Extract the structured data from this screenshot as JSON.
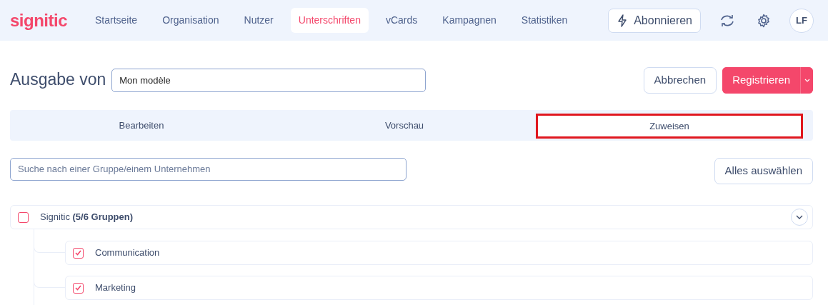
{
  "brand": "signitic",
  "nav": [
    {
      "label": "Startseite",
      "selected": false
    },
    {
      "label": "Organisation",
      "selected": false
    },
    {
      "label": "Nutzer",
      "selected": false
    },
    {
      "label": "Unterschriften",
      "selected": true
    },
    {
      "label": "vCards",
      "selected": false
    },
    {
      "label": "Kampagnen",
      "selected": false
    },
    {
      "label": "Statistiken",
      "selected": false
    }
  ],
  "subscribe_button": "Abonnieren",
  "avatar": "LF",
  "title": "Ausgabe von",
  "name_field": {
    "value": "Mon modèle"
  },
  "cancel_button": "Abbrechen",
  "save_button": "Registrieren",
  "tabs": [
    {
      "label": "Bearbeiten",
      "selected": false
    },
    {
      "label": "Vorschau",
      "selected": false
    },
    {
      "label": "Zuweisen",
      "selected": true
    }
  ],
  "search": {
    "placeholder": "Suche nach einer Gruppe/einem Unternehmen"
  },
  "select_all_button": "Alles auswählen",
  "tree": [
    {
      "label": "Signitic **(5/6 Gruppen)**",
      "checked": false,
      "expanded": true,
      "children": [
        {
          "label": "Communication",
          "checked": true
        },
        {
          "label": "Marketing",
          "checked": true
        }
      ]
    }
  ]
}
